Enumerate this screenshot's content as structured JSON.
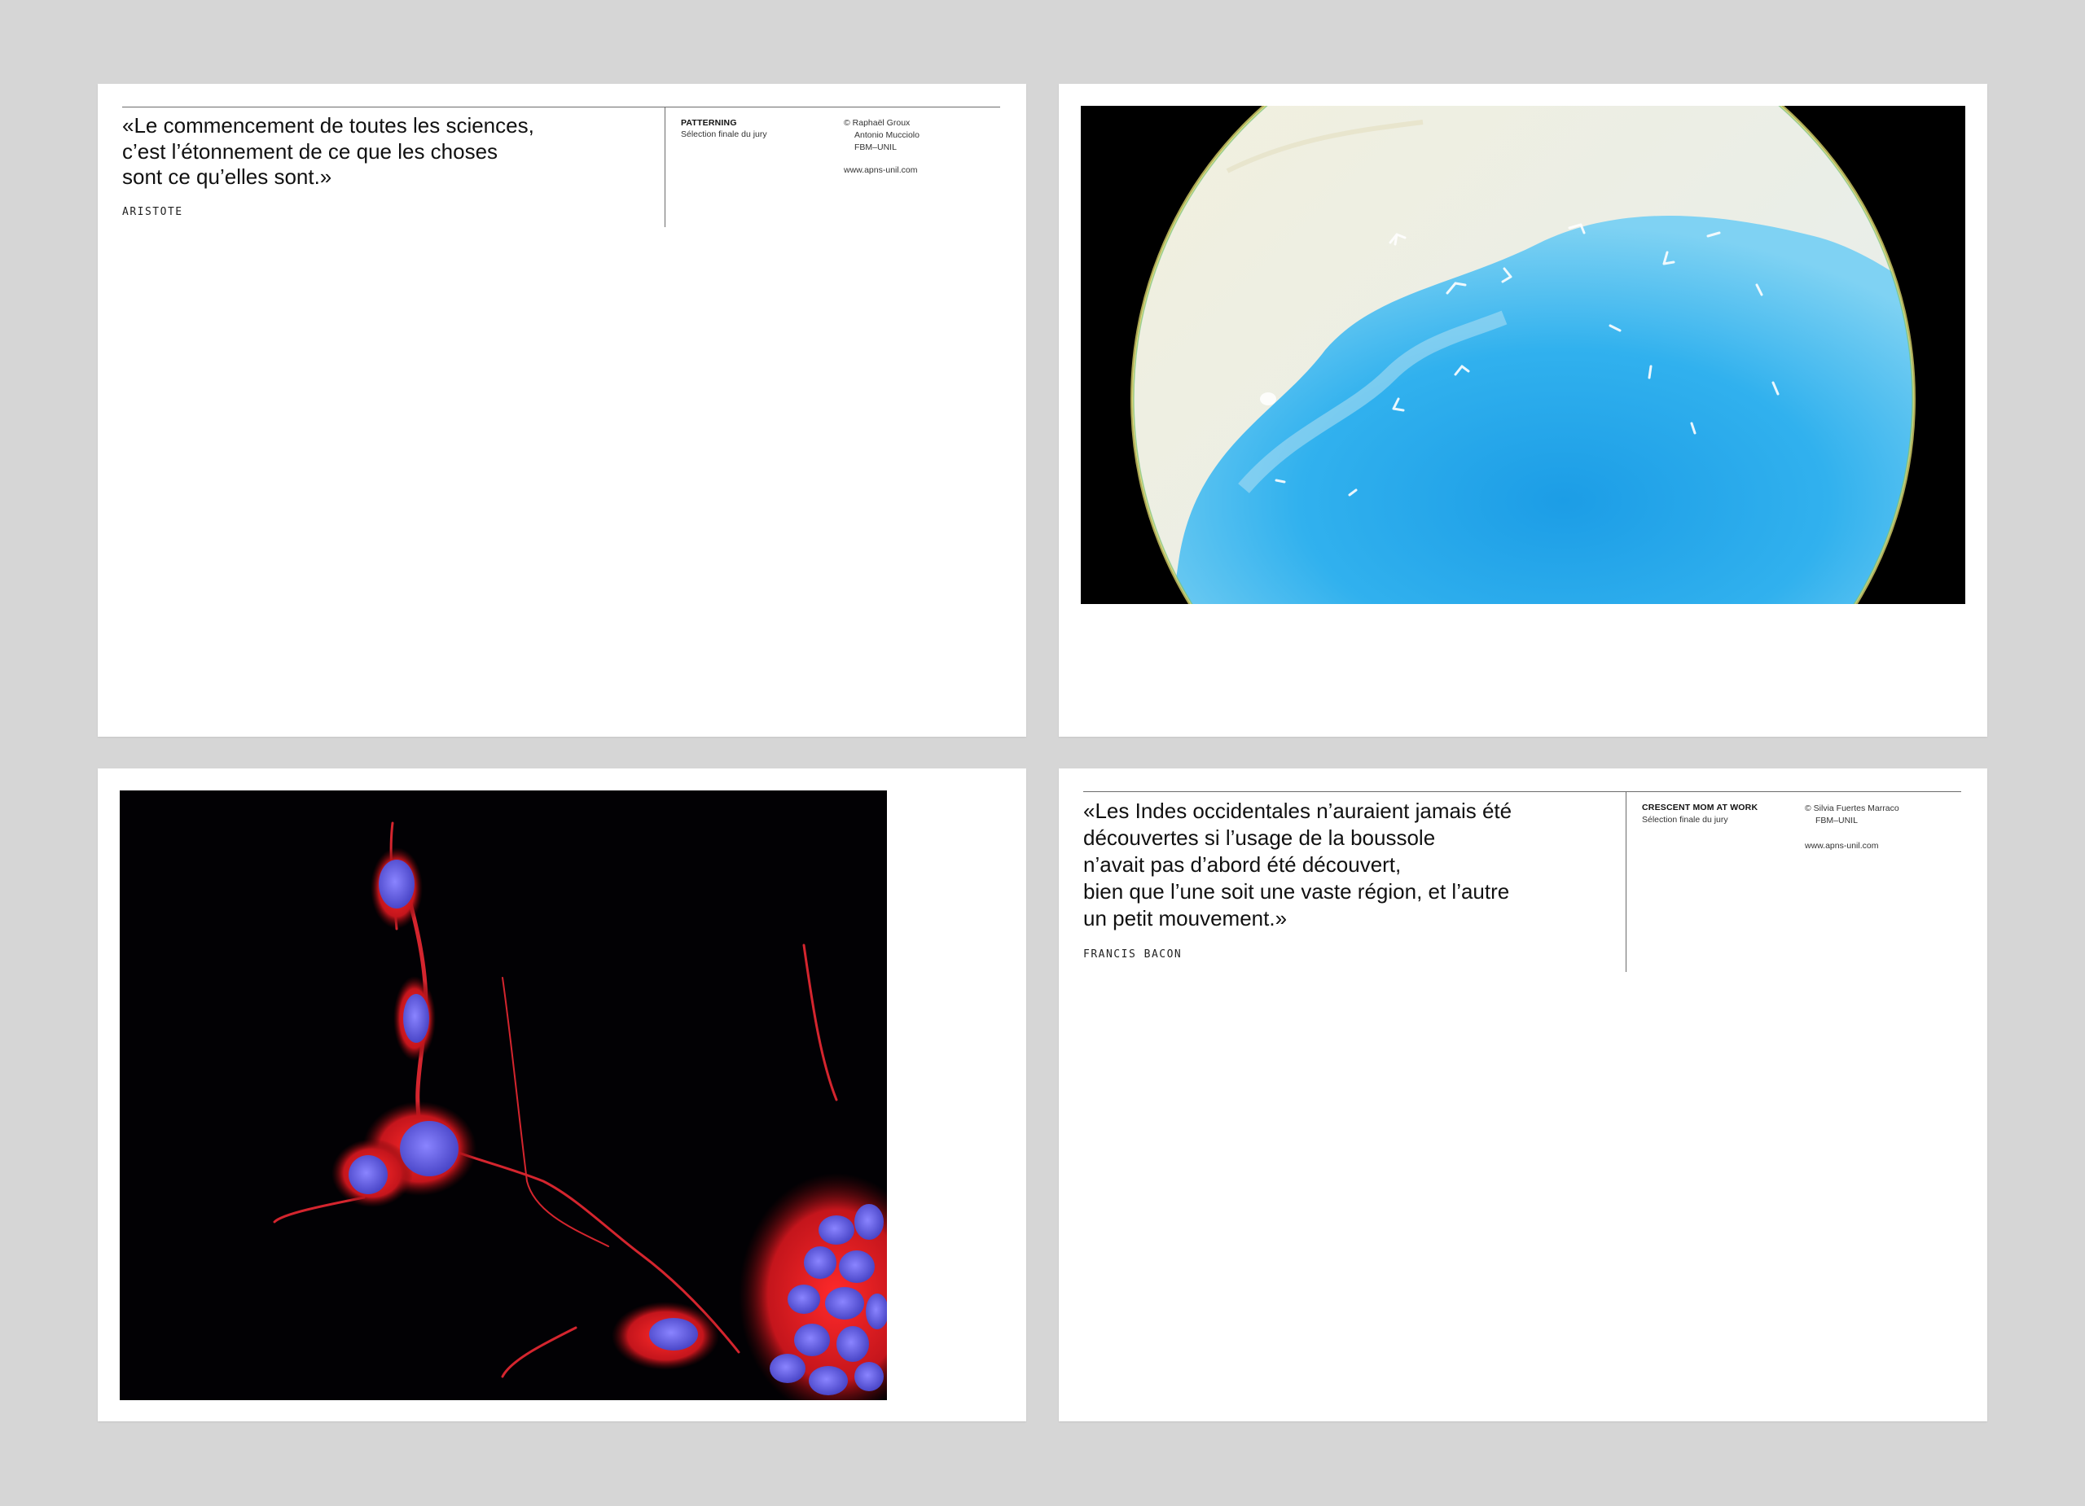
{
  "cards": [
    {
      "quote": "«Le commencement de toutes les sciences,\nc’est l’étonnement de ce que les choses\nsont ce qu’elles sont.»",
      "author": "ARISTOTE",
      "project_title": "PATTERNING",
      "project_subtitle": "Sélection finale du jury",
      "credits": [
        "© Raphaël Groux",
        "Antonio Mucciolo",
        "FBM–UNIL"
      ],
      "website": "www.apns-unil.com"
    },
    {
      "quote": "«Les Indes occidentales n’auraient jamais été\ndécouvertes si l’usage de la boussole\nn’avait pas d’abord été découvert,\nbien que l’une soit une vaste région, et l’autre\nun petit mouvement.»",
      "author": "FRANCIS BACON",
      "project_title": "CRESCENT MOM AT WORK",
      "project_subtitle": "Sélection finale du jury",
      "credits": [
        "© Silvia Fuertes Marraco",
        "FBM–UNIL"
      ],
      "website": "www.apns-unil.com"
    }
  ],
  "colors": {
    "background": "#d6d6d6",
    "card": "#ffffff",
    "rule": "#6b6b6b",
    "microscope_blue": "#1aa3e6",
    "cell_red": "#e0202a",
    "cell_blue": "#5a5ce0"
  }
}
